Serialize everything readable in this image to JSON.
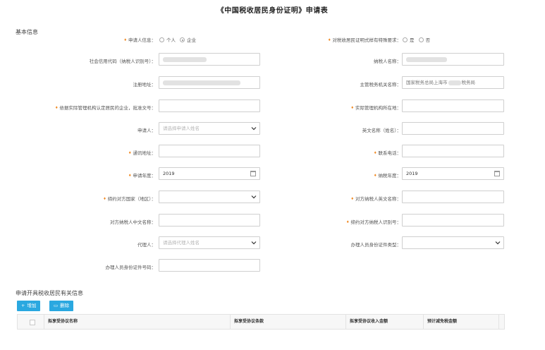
{
  "page": {
    "title": "《中国税收居民身份证明》申请表"
  },
  "sections": {
    "basic": "基本信息",
    "related": "申请开具税收居民有关信息"
  },
  "left": {
    "applicant_info": {
      "label": "申请人信息：",
      "option_person": "个人",
      "option_company": "企业",
      "selected": "企业"
    },
    "credit_code": {
      "label": "社会信用代码（纳税人识别号）：",
      "value": ""
    },
    "reg_address": {
      "label": "注册地址：",
      "value": ""
    },
    "approval_no": {
      "label": "依据实际管理机构认定居民的企业，批准文号：",
      "value": ""
    },
    "applicant": {
      "label": "申请人：",
      "placeholder": "请选择申请人姓名"
    },
    "contact_address": {
      "label": "通讯地址：",
      "value": ""
    },
    "apply_year": {
      "label": "申请年度：",
      "value": "2019"
    },
    "treaty_country": {
      "label": "缔约对方国家（地区）：",
      "value": ""
    },
    "counterparty_cn_name": {
      "label": "对方纳税人中文名称：",
      "value": ""
    },
    "agent": {
      "label": "代理人：",
      "placeholder": "请选择代理人姓名"
    },
    "handler_id_no": {
      "label": "办理人员身份证件号码：",
      "value": ""
    }
  },
  "right": {
    "special_format": {
      "label": "对税收居民证明式样有特殊要求：",
      "option_yes": "是",
      "option_no": "否",
      "selected": ""
    },
    "taxpayer_name": {
      "label": "纳税人名称：",
      "value": ""
    },
    "tax_authority": {
      "label": "主管税务机关名称：",
      "value_prefix": "国家税务总局上海市",
      "value_suffix": "税务局"
    },
    "actual_mgmt_location": {
      "label": "实际管理机构所在地：",
      "value": ""
    },
    "english_name": {
      "label": "英文名称（姓名）：",
      "value": ""
    },
    "phone": {
      "label": "联系电话：",
      "value": ""
    },
    "tax_year": {
      "label": "纳税年度：",
      "value": "2019"
    },
    "counterparty_en_name": {
      "label": "对方纳税人英文名称：",
      "value": ""
    },
    "counterparty_tax_id": {
      "label": "缔约对方纳税人识别号：",
      "value": ""
    },
    "handler_id_type": {
      "label": "办理人员身份证件类型：",
      "value": ""
    }
  },
  "toolbar": {
    "add_label": "增加",
    "delete_label": "删除"
  },
  "table": {
    "headers": [
      "拟享受协议名称",
      "拟享受协议条款",
      "拟享受协议收入金额",
      "预计减免税金额"
    ]
  }
}
